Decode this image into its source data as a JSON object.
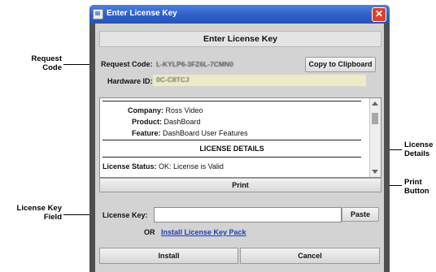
{
  "window": {
    "title": "Enter License Key",
    "close_glyph": "✕"
  },
  "header": {
    "title": "Enter License Key"
  },
  "request": {
    "code_label": "Request Code:",
    "code_value": "L-KYLP6-3FZ6L-7CMN0",
    "copy_button": "Copy to Clipboard",
    "hardware_label": "Hardware ID:",
    "hardware_value": "0C-C8TCJ"
  },
  "license_info": {
    "company_label": "Company:",
    "company_value": "Ross Video",
    "product_label": "Product:",
    "product_value": "DashBoard",
    "feature_label": "Feature:",
    "feature_value": "DashBoard User Features",
    "details_heading": "LICENSE DETAILS",
    "status_label": "License Status:",
    "status_value": "OK: License is Valid"
  },
  "print_button": "Print",
  "license_key": {
    "label": "License Key:",
    "value": "",
    "paste_button": "Paste",
    "or_text": "OR",
    "install_pack_link": "Install License Key Pack"
  },
  "footer": {
    "install_button": "Install",
    "cancel_button": "Cancel"
  },
  "callouts": {
    "request_code": "Request\nCode",
    "license_details": "License\nDetails",
    "print_button": "Print\nButton",
    "license_key_field": "License Key\nField"
  }
}
